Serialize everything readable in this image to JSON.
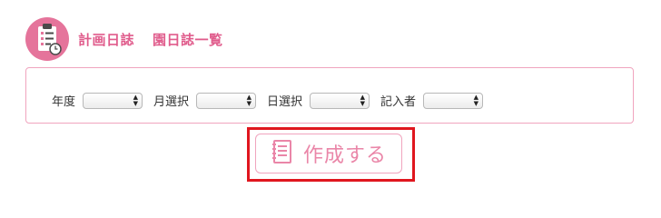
{
  "header": {
    "title_primary": "計画日誌",
    "title_secondary": "園日誌一覧"
  },
  "filters": [
    {
      "label": "年度",
      "value": ""
    },
    {
      "label": "月選択",
      "value": ""
    },
    {
      "label": "日選択",
      "value": ""
    },
    {
      "label": "記入者",
      "value": ""
    }
  ],
  "create_button": {
    "label": "作成する",
    "icon": "notebook-icon"
  },
  "colors": {
    "accent": "#e05c8c",
    "border": "#f0a4be",
    "highlight": "#e0161e"
  }
}
